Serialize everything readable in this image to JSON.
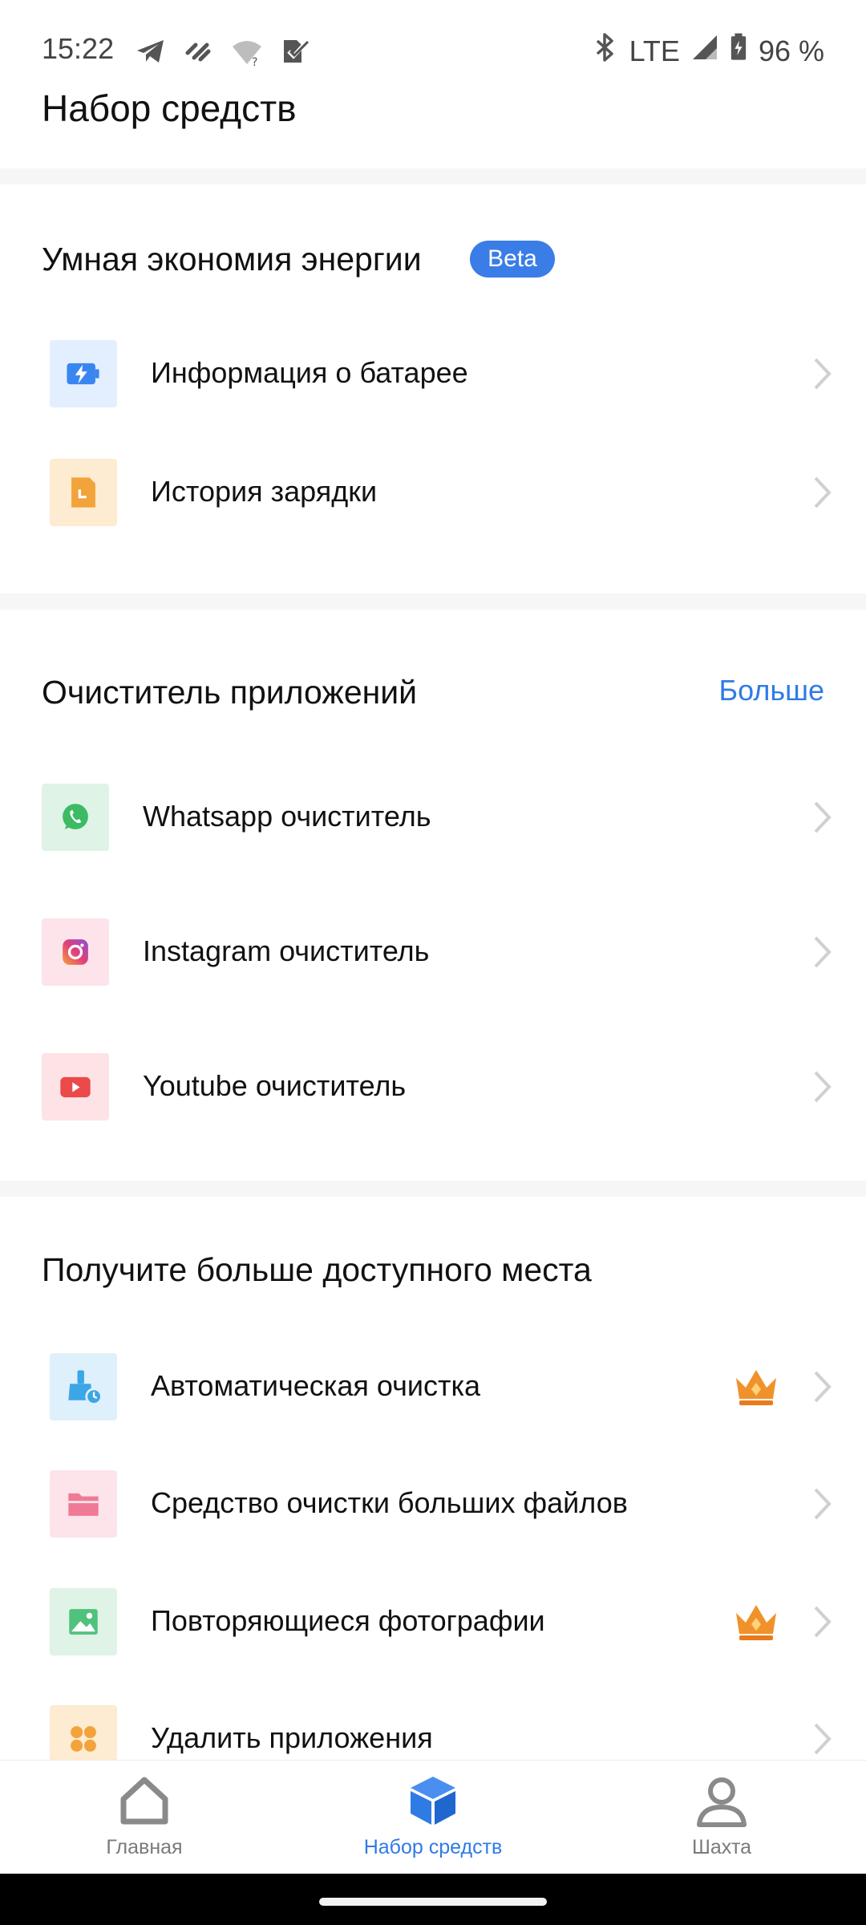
{
  "status_bar": {
    "time": "15:22",
    "network": "LTE",
    "battery": "96 %",
    "left_icons": [
      "telegram-icon",
      "app-icon",
      "wifi-unknown-icon",
      "check-icon"
    ],
    "right_icons": [
      "bluetooth-icon",
      "signal-icon",
      "battery-charging-icon"
    ]
  },
  "page": {
    "title": "Набор средств"
  },
  "energy_section": {
    "title": "Умная экономия энергии",
    "badge": "Beta",
    "items": [
      {
        "label": "Информация о батарее",
        "icon": "battery-info-icon",
        "icon_bg": "#e3efff",
        "icon_color": "#3a86f0"
      },
      {
        "label": "История зарядки",
        "icon": "charging-history-icon",
        "icon_bg": "#fdebd2",
        "icon_color": "#f2a33a"
      }
    ]
  },
  "cleaner_section": {
    "title": "Очиститель приложений",
    "more": "Больше",
    "items": [
      {
        "label": "Whatsapp очиститель",
        "icon": "whatsapp-icon",
        "icon_bg": "#dff3e6",
        "icon_color": "#3cba64"
      },
      {
        "label": "Instagram очиститель",
        "icon": "instagram-icon",
        "icon_bg": "#fde4ea",
        "icon_color": "#d83d8a"
      },
      {
        "label": "Youtube очиститель",
        "icon": "youtube-icon",
        "icon_bg": "#fde3e6",
        "icon_color": "#ea4a4a"
      }
    ]
  },
  "space_section": {
    "title": "Получите больше доступного места",
    "items": [
      {
        "label": "Автоматическая очистка",
        "icon": "auto-clean-icon",
        "icon_bg": "#def0fb",
        "icon_color": "#3ca6e6",
        "premium": true
      },
      {
        "label": "Средство очистки больших файлов",
        "icon": "folder-icon",
        "icon_bg": "#fde4ea",
        "icon_color": "#ef7a95",
        "premium": false
      },
      {
        "label": "Повторяющиеся фотографии",
        "icon": "image-icon",
        "icon_bg": "#dff3e6",
        "icon_color": "#4fc27e",
        "premium": true
      },
      {
        "label": "Удалить приложения",
        "icon": "apps-grid-icon",
        "icon_bg": "#fdebd2",
        "icon_color": "#f2a33a",
        "premium": false
      }
    ]
  },
  "bottom_nav": {
    "items": [
      {
        "label": "Главная",
        "icon": "home-icon",
        "active": false
      },
      {
        "label": "Набор средств",
        "icon": "toolbox-icon",
        "active": true
      },
      {
        "label": "Шахта",
        "icon": "profile-icon",
        "active": false
      }
    ]
  },
  "colors": {
    "accent": "#2f7be5",
    "premium": "#f0922b"
  }
}
